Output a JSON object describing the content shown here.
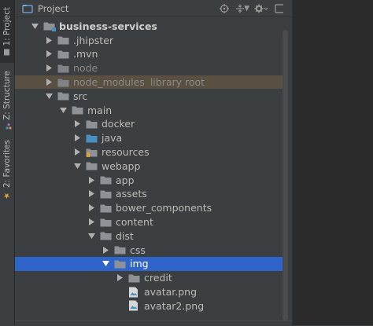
{
  "side_tabs": [
    {
      "label": "1: Project",
      "active": true
    },
    {
      "label": "Z: Structure",
      "active": false
    },
    {
      "label": "2: Favorites",
      "active": false
    }
  ],
  "header": {
    "title": "Project",
    "dropdown_icon": "caret-down-icon",
    "buttons": [
      "locate-icon",
      "collapse-all-icon",
      "settings-icon",
      "hide-icon"
    ]
  },
  "tree": [
    {
      "label": "business-services",
      "depth": 0,
      "expanded": true,
      "icon": "module-folder",
      "bold": true
    },
    {
      "label": ".jhipster",
      "depth": 1,
      "expanded": false,
      "icon": "folder"
    },
    {
      "label": ".mvn",
      "depth": 1,
      "expanded": false,
      "icon": "folder"
    },
    {
      "label": "node",
      "depth": 1,
      "expanded": false,
      "icon": "folder",
      "muted": true
    },
    {
      "label": "node_modules",
      "extra": "library root",
      "depth": 1,
      "expanded": false,
      "icon": "folder",
      "muted": true,
      "highlight": true
    },
    {
      "label": "src",
      "depth": 1,
      "expanded": true,
      "icon": "folder"
    },
    {
      "label": "main",
      "depth": 2,
      "expanded": true,
      "icon": "folder"
    },
    {
      "label": "docker",
      "depth": 3,
      "expanded": false,
      "icon": "folder"
    },
    {
      "label": "java",
      "depth": 3,
      "expanded": false,
      "icon": "source-folder"
    },
    {
      "label": "resources",
      "depth": 3,
      "expanded": false,
      "icon": "resource-folder"
    },
    {
      "label": "webapp",
      "depth": 3,
      "expanded": true,
      "icon": "folder"
    },
    {
      "label": "app",
      "depth": 4,
      "expanded": false,
      "icon": "folder"
    },
    {
      "label": "assets",
      "depth": 4,
      "expanded": false,
      "icon": "folder"
    },
    {
      "label": "bower_components",
      "depth": 4,
      "expanded": false,
      "icon": "folder"
    },
    {
      "label": "content",
      "depth": 4,
      "expanded": false,
      "icon": "folder"
    },
    {
      "label": "dist",
      "depth": 4,
      "expanded": true,
      "icon": "folder"
    },
    {
      "label": "css",
      "depth": 5,
      "expanded": false,
      "icon": "folder"
    },
    {
      "label": "img",
      "depth": 5,
      "expanded": true,
      "icon": "folder",
      "selected": true
    },
    {
      "label": "credit",
      "depth": 6,
      "expanded": false,
      "icon": "folder"
    },
    {
      "label": "avatar.png",
      "depth": 6,
      "icon": "image-file"
    },
    {
      "label": "avatar2.png",
      "depth": 6,
      "icon": "image-file"
    }
  ],
  "colors": {
    "panel_bg": "#3c3f41",
    "selection": "#2f65ca",
    "highlight": "#5a5042",
    "folder": "#8e9296",
    "source_folder": "#4a8fc0"
  }
}
